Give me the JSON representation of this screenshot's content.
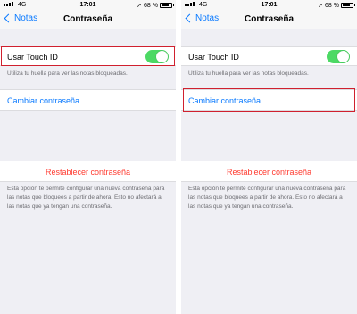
{
  "status_bar": {
    "carrier": "4G",
    "time": "17:01",
    "battery": "68 %",
    "battery_level": 0.68
  },
  "nav": {
    "back_label": "Notas",
    "title": "Contraseña"
  },
  "touch_id": {
    "label": "Usar Touch ID",
    "enabled": true,
    "footnote": "Utiliza tu huella para ver las notas bloqueadas."
  },
  "change_password": {
    "label": "Cambiar contraseña..."
  },
  "reset_password": {
    "label": "Restablecer contraseña",
    "footnote": "Esta opción te permite configurar una nueva contraseña para las notas que bloquees a partir de ahora. Esto no afectará a las notas que ya tengan una contraseña."
  },
  "colors": {
    "accent": "#0a7aff",
    "toggle_on": "#4cd964",
    "destructive": "#ff3b30",
    "highlight": "#d0202e"
  }
}
